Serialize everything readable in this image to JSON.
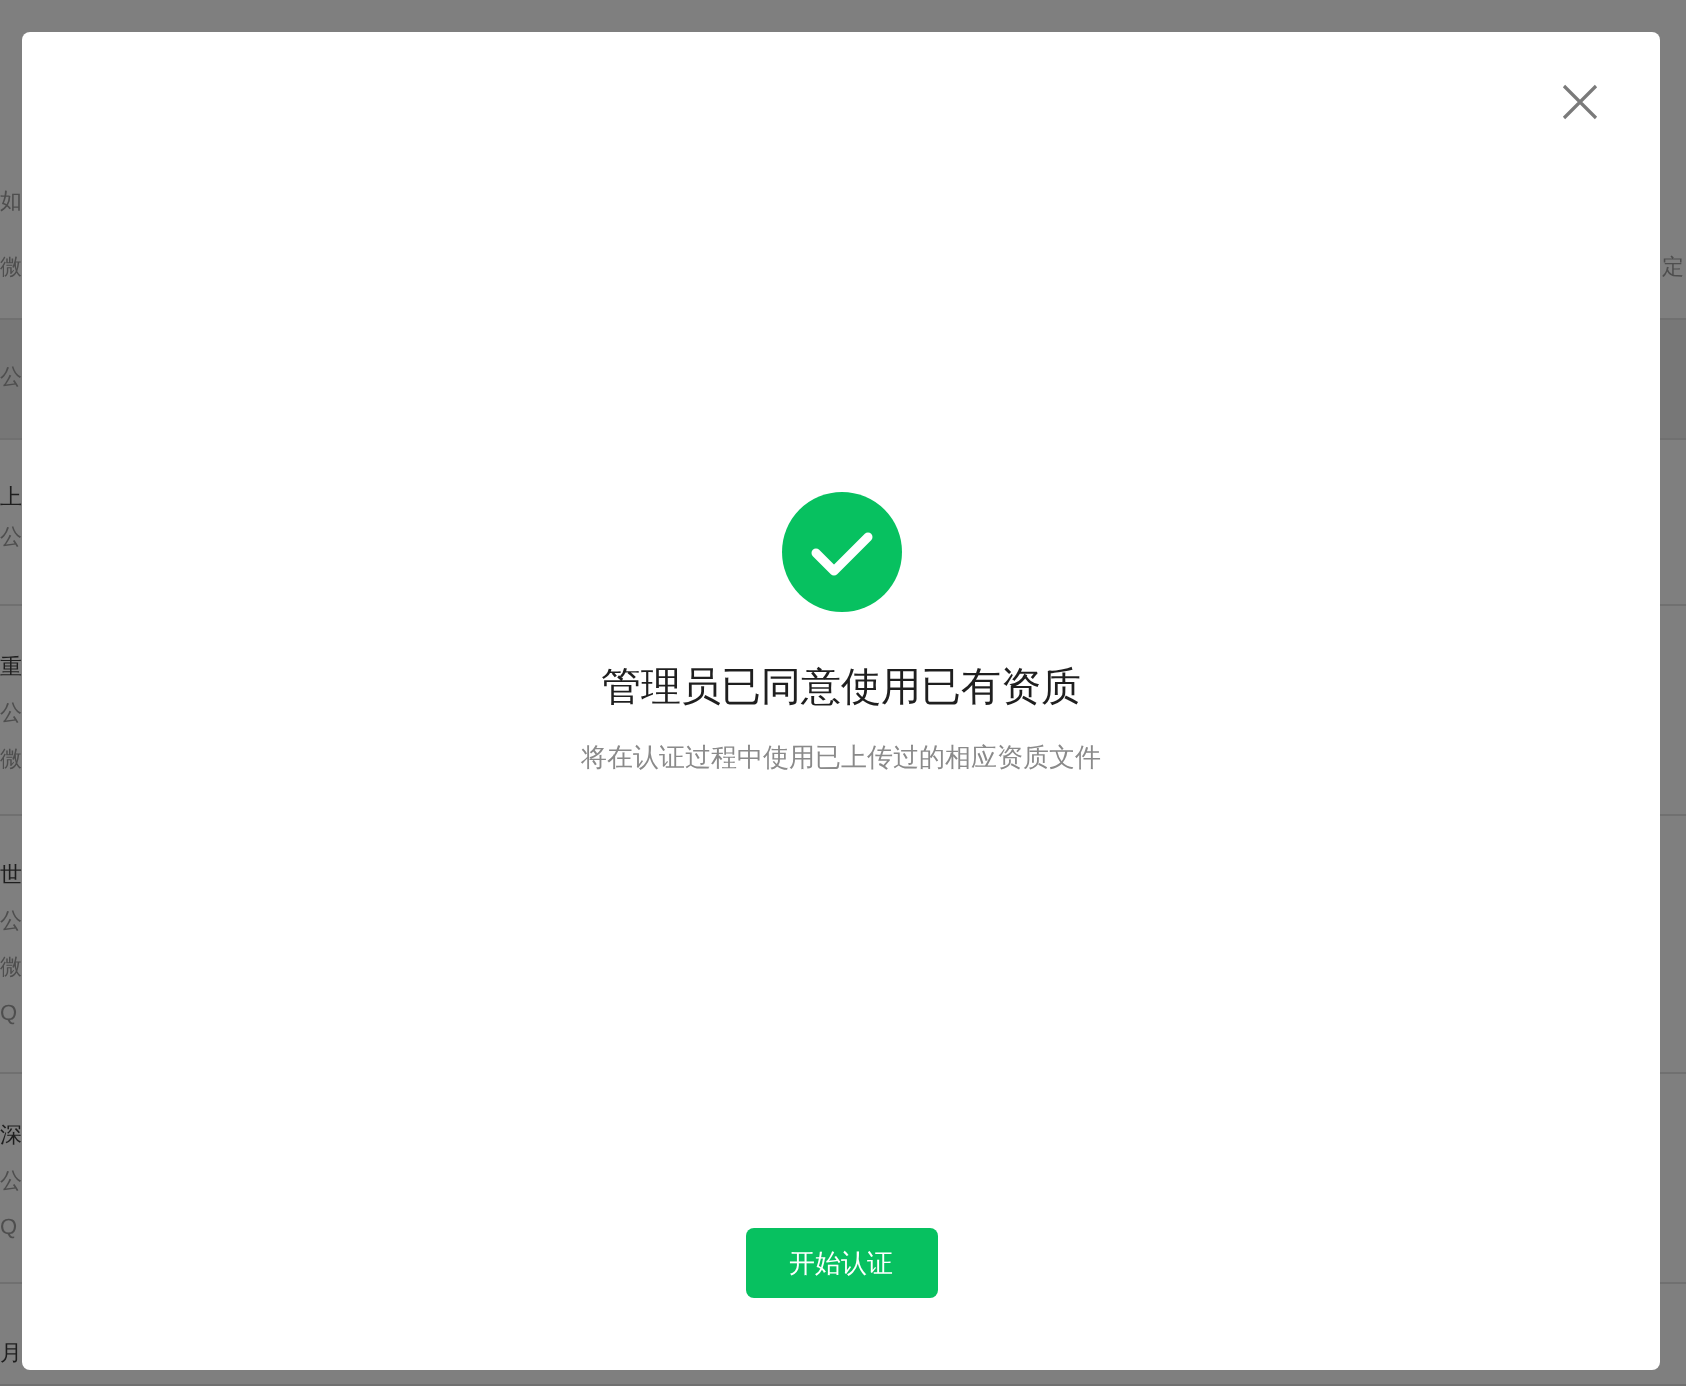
{
  "background_list": {
    "rows": [
      {
        "kind": "item",
        "lines": [
          "如",
          "微"
        ],
        "right_lines": [
          "定"
        ]
      },
      {
        "kind": "section",
        "lines": [
          "公"
        ]
      },
      {
        "kind": "item",
        "title": "上",
        "lines": [
          "公"
        ]
      },
      {
        "kind": "item",
        "title": "重",
        "lines": [
          "公",
          "微"
        ]
      },
      {
        "kind": "item",
        "title": "世",
        "lines": [
          "公",
          "微",
          "Q"
        ]
      },
      {
        "kind": "item",
        "title": "深",
        "lines": [
          "公",
          "Q"
        ]
      },
      {
        "kind": "item",
        "title": "月"
      }
    ]
  },
  "dialog": {
    "message": "管理员已同意使用已有资质",
    "description": "将在认证过程中使用已上传过的相应资质文件",
    "button": "开始认证"
  }
}
